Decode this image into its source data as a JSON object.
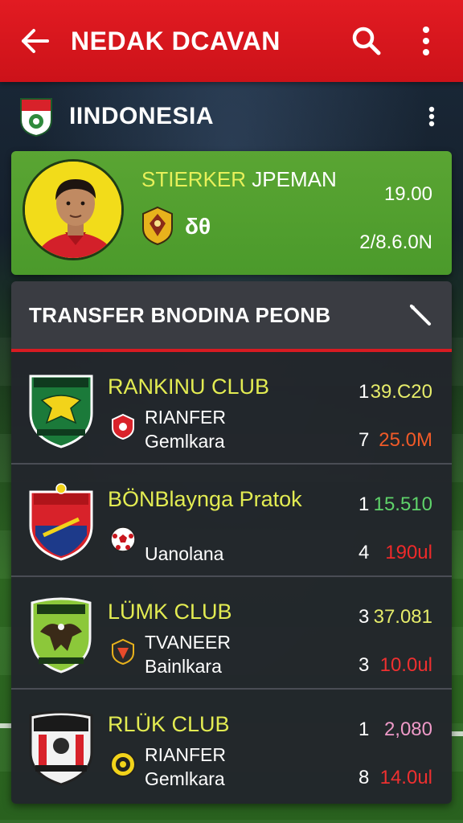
{
  "header": {
    "title": "NEDAK DCAVAN",
    "back_icon": "arrow-left-icon",
    "search_icon": "search-icon",
    "menu_icon": "more-vertical-icon",
    "color": "#e21b22"
  },
  "country": {
    "name": "IINDONESIA"
  },
  "player": {
    "role_part1": "STIERKER",
    "role_part2": " JPEMAN",
    "number": "δθ",
    "value_top": "19.00",
    "value_bottom": "2/8.6.0N",
    "card_color": "#52a02f"
  },
  "transfer_panel": {
    "title": "TRANSFER BNODINA PEONB",
    "accent": "#d81b22",
    "clubs": [
      {
        "name": "RANKINU CLUB",
        "sub1": "RIANFER",
        "sub2": "Gemlkara",
        "rank1": "1",
        "rank2": "7",
        "amount1": "39.C20",
        "amount1_color": "#e6ec6a",
        "amount2": "25.0M",
        "amount2_color": "#f05a28"
      },
      {
        "name": "BÖNBlaynga Pratok",
        "sub1": "",
        "sub2": "Uanolana",
        "rank1": "1",
        "rank2": "4",
        "amount1": "15.510",
        "amount1_color": "#5fd36a",
        "amount2": "190ul",
        "amount2_color": "#ee2a2a"
      },
      {
        "name": "LÜMK CLUB",
        "sub1": "TVANEER",
        "sub2": "Bainlkara",
        "rank1": "3",
        "rank2": "3",
        "amount1": "37.081",
        "amount1_color": "#e6ec6a",
        "amount2": "10.0ul",
        "amount2_color": "#ee3030"
      },
      {
        "name": "RLÜK CLUB",
        "sub1": "RIANFER",
        "sub2": "Gemlkara",
        "rank1": "1",
        "rank2": "8",
        "amount1": "2,080",
        "amount1_color": "#ee9ac8",
        "amount2": "14.0ul",
        "amount2_color": "#ee3030"
      }
    ]
  }
}
